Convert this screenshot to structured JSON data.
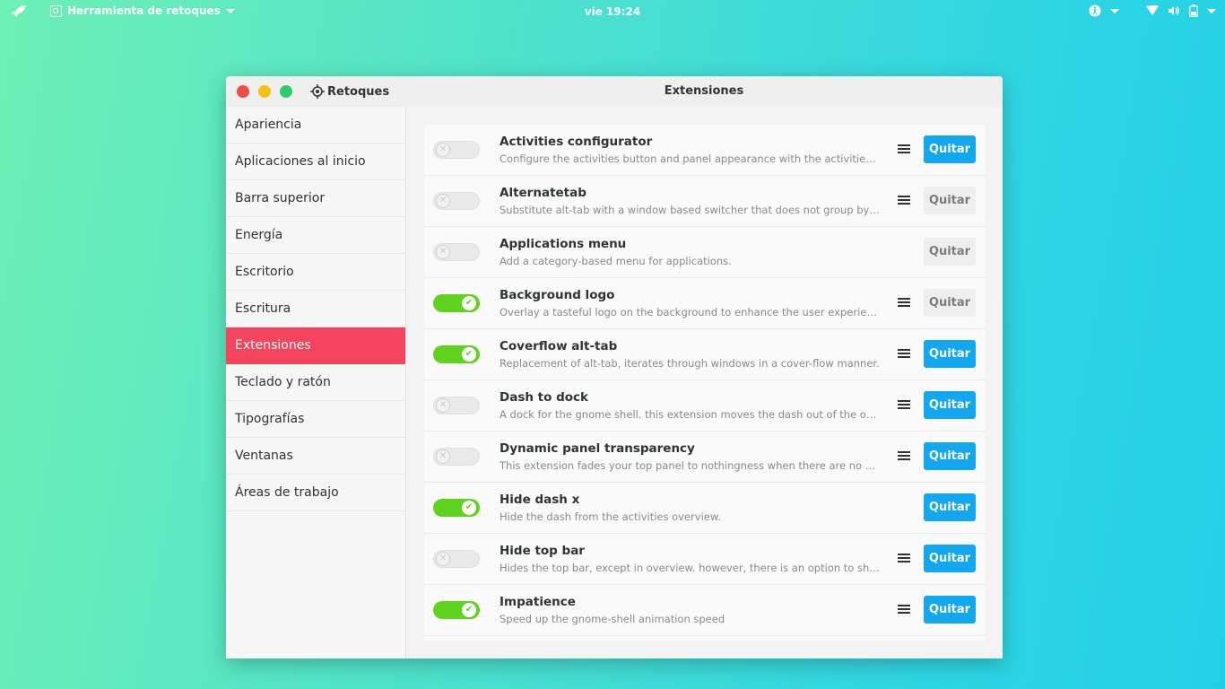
{
  "topbar": {
    "app_name": "Herramienta de retoques",
    "clock": "vie 19:24",
    "icons": [
      "rocket-icon",
      "accessibility-icon",
      "wifi-icon",
      "volume-icon",
      "battery-icon"
    ]
  },
  "window": {
    "app_title": "Retoques",
    "page_title": "Extensiones",
    "controls": {
      "close_color": "#f14b45",
      "minimize_color": "#f5c211",
      "maximize_color": "#2ecc71"
    }
  },
  "sidebar": {
    "items": [
      {
        "label": "Apariencia"
      },
      {
        "label": "Aplicaciones al inicio"
      },
      {
        "label": "Barra superior"
      },
      {
        "label": "Energía"
      },
      {
        "label": "Escritorio"
      },
      {
        "label": "Escritura"
      },
      {
        "label": "Extensiones",
        "active": true
      },
      {
        "label": "Teclado y ratón"
      },
      {
        "label": "Tipografías"
      },
      {
        "label": "Ventanas"
      },
      {
        "label": "Áreas de trabajo"
      }
    ],
    "active_color": "#f5445e"
  },
  "extensions": [
    {
      "name": "Activities configurator",
      "description": "Configure the activities button and panel appearance with the activities configurator",
      "enabled": false,
      "has_menu": true,
      "remove_label": "Quitar",
      "remove_style": "primary"
    },
    {
      "name": "Alternatetab",
      "description": "Substitute alt-tab with a window based switcher that does not group by application",
      "enabled": false,
      "has_menu": true,
      "remove_label": "Quitar",
      "remove_style": "plain"
    },
    {
      "name": "Applications menu",
      "description": "Add a category-based menu for applications.",
      "enabled": false,
      "has_menu": false,
      "remove_label": "Quitar",
      "remove_style": "plain"
    },
    {
      "name": "Background logo",
      "description": "Overlay a tasteful logo on the background to enhance the user experience",
      "enabled": true,
      "has_menu": true,
      "remove_label": "Quitar",
      "remove_style": "plain"
    },
    {
      "name": "Coverflow alt-tab",
      "description": "Replacement of alt-tab, iterates through windows in a cover-flow manner.",
      "enabled": true,
      "has_menu": true,
      "remove_label": "Quitar",
      "remove_style": "primary"
    },
    {
      "name": "Dash to dock",
      "description": "A dock for the gnome shell. this extension moves the dash out of the overview",
      "enabled": false,
      "has_menu": true,
      "remove_label": "Quitar",
      "remove_style": "primary"
    },
    {
      "name": "Dynamic panel transparency",
      "description": "This extension fades your top panel to nothingness when there are no maximized windows",
      "enabled": false,
      "has_menu": true,
      "remove_label": "Quitar",
      "remove_style": "primary"
    },
    {
      "name": "Hide dash x",
      "description": "Hide the dash from the activities overview.",
      "enabled": true,
      "has_menu": false,
      "remove_label": "Quitar",
      "remove_style": "primary"
    },
    {
      "name": "Hide top bar",
      "description": "Hides the top bar, except in overview. however, there is an option to show the panel",
      "enabled": false,
      "has_menu": true,
      "remove_label": "Quitar",
      "remove_style": "primary"
    },
    {
      "name": "Impatience",
      "description": "Speed up the gnome-shell animation speed",
      "enabled": true,
      "has_menu": true,
      "remove_label": "Quitar",
      "remove_style": "primary"
    }
  ],
  "colors": {
    "toggle_on": "#5fd31f",
    "button_primary": "#13a7ef"
  }
}
